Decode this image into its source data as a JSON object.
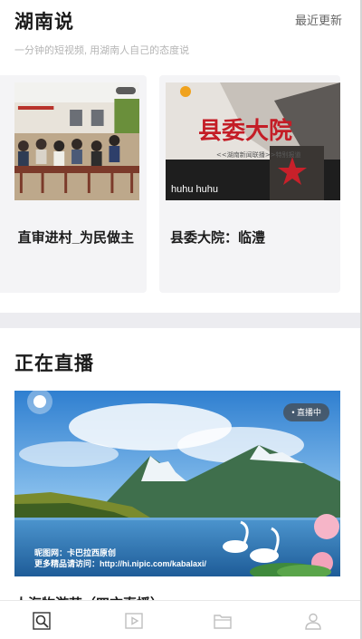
{
  "section_hunan": {
    "title": "湖南说",
    "more_label": "最近更新",
    "subtitle": "一分钟的短视频, 用湖南人自己的态度说"
  },
  "cards": [
    {
      "title": "直审进村_为民做主",
      "thumb_caption": "",
      "thumb_icon": "meeting-photo"
    },
    {
      "title": "县委大院：临澧",
      "thumb_caption": "huhu huhu",
      "thumb_icon": "poster-photo"
    }
  ],
  "section_live": {
    "title": "正在直播",
    "badge": "• 直播中",
    "watermark_line1": "昵图网：卡巴拉西原创",
    "watermark_line2": "更多精品请访问：http://hi.nipic.com/kabalaxi/",
    "next_title_partial": "人海物游艺（四方直播）"
  },
  "poster_text": {
    "big": "县委大院",
    "small": "<<湖南新闻联播>>特别报道"
  },
  "tabbar": {
    "items": [
      {
        "icon": "discover-search-icon",
        "active": true
      },
      {
        "icon": "video-play-icon",
        "active": false
      },
      {
        "icon": "folder-icon",
        "active": false
      },
      {
        "icon": "user-icon",
        "active": false
      }
    ]
  },
  "colors": {
    "divider_band": "#ececf0",
    "card_bg": "#f4f4f6",
    "tab_inactive": "#bfbfbf",
    "tab_active": "#333333"
  }
}
